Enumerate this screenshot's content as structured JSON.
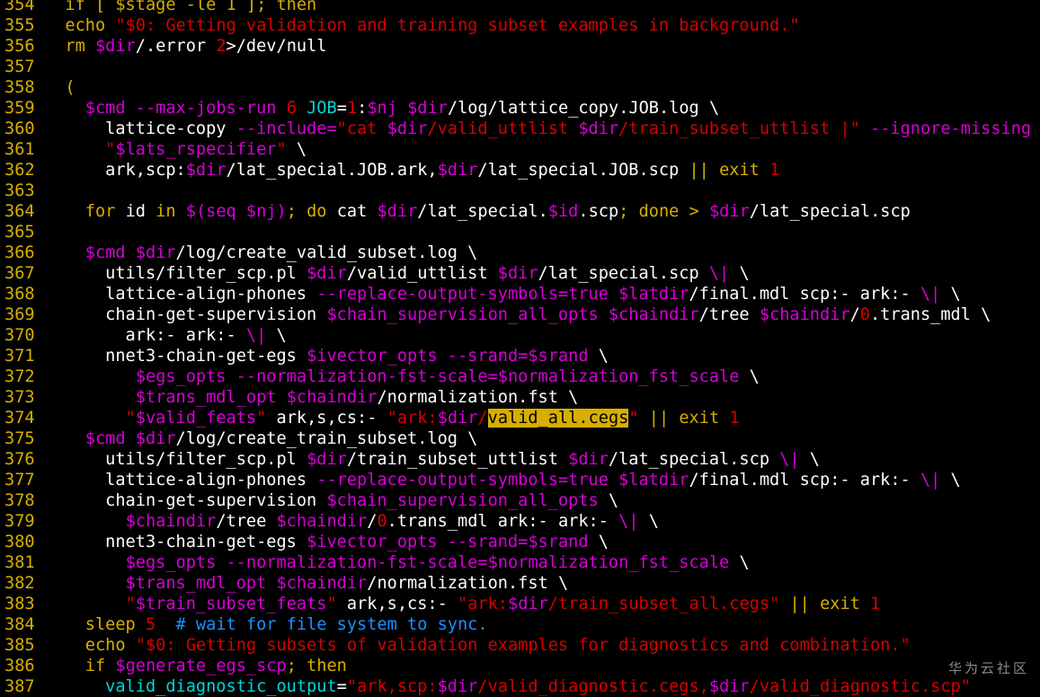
{
  "colors": {
    "background": "#000000",
    "line_number": "#d7af00",
    "default_text": "#ffffff",
    "keyword": "#d7af00",
    "string_literal": "#d70000",
    "variable": "#d700d7",
    "builtin": "#00d7d7",
    "comment": "#1e90ff",
    "search_highlight_bg": "#d7af00"
  },
  "editor": {
    "lines": [
      {
        "num": "354",
        "segments": [
          [
            "y",
            "  if [ $stage -le 1 ]; then"
          ]
        ]
      },
      {
        "num": "355",
        "segments": [
          [
            "y",
            "  echo "
          ],
          [
            "r",
            "\"$0: Getting validation and training subset examples in background.\""
          ]
        ]
      },
      {
        "num": "356",
        "segments": [
          [
            "y",
            "  rm "
          ],
          [
            "p",
            "$dir"
          ],
          [
            "w",
            "/.error "
          ],
          [
            "r",
            "2"
          ],
          [
            "w",
            ">/dev/null"
          ]
        ]
      },
      {
        "num": "357",
        "segments": []
      },
      {
        "num": "358",
        "segments": [
          [
            "y",
            "  ("
          ]
        ]
      },
      {
        "num": "359",
        "segments": [
          [
            "w",
            "    "
          ],
          [
            "p",
            "$cmd"
          ],
          [
            "w",
            " "
          ],
          [
            "p",
            "--max-jobs-run"
          ],
          [
            "w",
            " "
          ],
          [
            "r",
            "6"
          ],
          [
            "w",
            " "
          ],
          [
            "c",
            "JOB"
          ],
          [
            "w",
            "="
          ],
          [
            "r",
            "1"
          ],
          [
            "w",
            ":"
          ],
          [
            "p",
            "$nj"
          ],
          [
            "w",
            " "
          ],
          [
            "p",
            "$dir"
          ],
          [
            "w",
            "/log/lattice_copy.JOB.log \\"
          ]
        ]
      },
      {
        "num": "360",
        "segments": [
          [
            "w",
            "      lattice-copy "
          ],
          [
            "p",
            "--include="
          ],
          [
            "r",
            "\"cat "
          ],
          [
            "p",
            "$dir"
          ],
          [
            "r",
            "/valid_uttlist "
          ],
          [
            "p",
            "$dir"
          ],
          [
            "r",
            "/train_subset_uttlist |\""
          ],
          [
            "w",
            " "
          ],
          [
            "p",
            "--ignore-missing"
          ],
          [
            "w",
            " \\"
          ]
        ]
      },
      {
        "num": "361",
        "segments": [
          [
            "w",
            "      "
          ],
          [
            "r",
            "\""
          ],
          [
            "p",
            "$lats_rspecifier"
          ],
          [
            "r",
            "\""
          ],
          [
            "w",
            " \\"
          ]
        ]
      },
      {
        "num": "362",
        "segments": [
          [
            "w",
            "      ark,scp:"
          ],
          [
            "p",
            "$dir"
          ],
          [
            "w",
            "/lat_special.JOB.ark,"
          ],
          [
            "p",
            "$dir"
          ],
          [
            "w",
            "/lat_special.JOB.scp "
          ],
          [
            "y",
            "||"
          ],
          [
            "w",
            " "
          ],
          [
            "y",
            "exit"
          ],
          [
            "w",
            " "
          ],
          [
            "r",
            "1"
          ]
        ]
      },
      {
        "num": "363",
        "segments": []
      },
      {
        "num": "364",
        "segments": [
          [
            "w",
            "    "
          ],
          [
            "y",
            "for"
          ],
          [
            "w",
            " id "
          ],
          [
            "y",
            "in"
          ],
          [
            "w",
            " "
          ],
          [
            "p",
            "$(seq $nj)"
          ],
          [
            "y",
            ";"
          ],
          [
            "w",
            " "
          ],
          [
            "y",
            "do"
          ],
          [
            "w",
            " cat "
          ],
          [
            "p",
            "$dir"
          ],
          [
            "w",
            "/lat_special."
          ],
          [
            "p",
            "$id"
          ],
          [
            "w",
            ".scp"
          ],
          [
            "y",
            ";"
          ],
          [
            "w",
            " "
          ],
          [
            "y",
            "done"
          ],
          [
            "w",
            " "
          ],
          [
            "y",
            ">"
          ],
          [
            "w",
            " "
          ],
          [
            "p",
            "$dir"
          ],
          [
            "w",
            "/lat_special.scp"
          ]
        ]
      },
      {
        "num": "365",
        "segments": []
      },
      {
        "num": "366",
        "segments": [
          [
            "w",
            "    "
          ],
          [
            "p",
            "$cmd"
          ],
          [
            "w",
            " "
          ],
          [
            "p",
            "$dir"
          ],
          [
            "w",
            "/log/create_valid_subset.log \\"
          ]
        ]
      },
      {
        "num": "367",
        "segments": [
          [
            "w",
            "      utils/filter_scp.pl "
          ],
          [
            "p",
            "$dir"
          ],
          [
            "w",
            "/valid_uttlist "
          ],
          [
            "p",
            "$dir"
          ],
          [
            "w",
            "/lat_special.scp "
          ],
          [
            "p",
            "\\|"
          ],
          [
            "w",
            " \\"
          ]
        ]
      },
      {
        "num": "368",
        "segments": [
          [
            "w",
            "      lattice-align-phones "
          ],
          [
            "p",
            "--replace-output-symbols=true"
          ],
          [
            "w",
            " "
          ],
          [
            "p",
            "$latdir"
          ],
          [
            "w",
            "/final.mdl scp:- ark:- "
          ],
          [
            "p",
            "\\|"
          ],
          [
            "w",
            " \\"
          ]
        ]
      },
      {
        "num": "369",
        "segments": [
          [
            "w",
            "      chain-get-supervision "
          ],
          [
            "p",
            "$chain_supervision_all_opts"
          ],
          [
            "w",
            " "
          ],
          [
            "p",
            "$chaindir"
          ],
          [
            "w",
            "/tree "
          ],
          [
            "p",
            "$chaindir"
          ],
          [
            "w",
            "/"
          ],
          [
            "r",
            "0"
          ],
          [
            "w",
            ".trans_mdl \\"
          ]
        ]
      },
      {
        "num": "370",
        "segments": [
          [
            "w",
            "        ark:- ark:- "
          ],
          [
            "p",
            "\\|"
          ],
          [
            "w",
            " \\"
          ]
        ]
      },
      {
        "num": "371",
        "segments": [
          [
            "w",
            "      nnet3-chain-get-egs "
          ],
          [
            "p",
            "$ivector_opts"
          ],
          [
            "w",
            " "
          ],
          [
            "p",
            "--srand=$srand"
          ],
          [
            "w",
            " \\"
          ]
        ]
      },
      {
        "num": "372",
        "segments": [
          [
            "w",
            "         "
          ],
          [
            "p",
            "$egs_opts"
          ],
          [
            "w",
            " "
          ],
          [
            "p",
            "--normalization-fst-scale=$normalization_fst_scale"
          ],
          [
            "w",
            " \\"
          ]
        ]
      },
      {
        "num": "373",
        "segments": [
          [
            "w",
            "         "
          ],
          [
            "p",
            "$trans_mdl_opt"
          ],
          [
            "w",
            " "
          ],
          [
            "p",
            "$chaindir"
          ],
          [
            "w",
            "/normalization.fst \\"
          ]
        ]
      },
      {
        "num": "374",
        "segments": [
          [
            "w",
            "        "
          ],
          [
            "r",
            "\""
          ],
          [
            "p",
            "$valid_feats"
          ],
          [
            "r",
            "\""
          ],
          [
            "w",
            " ark,s,cs:- "
          ],
          [
            "r",
            "\"ark:"
          ],
          [
            "p",
            "$dir"
          ],
          [
            "r",
            "/"
          ],
          [
            "hl",
            "valid_all.cegs"
          ],
          [
            "r",
            "\""
          ],
          [
            "w",
            " "
          ],
          [
            "y",
            "||"
          ],
          [
            "w",
            " "
          ],
          [
            "y",
            "exit"
          ],
          [
            "w",
            " "
          ],
          [
            "r",
            "1"
          ]
        ]
      },
      {
        "num": "375",
        "segments": [
          [
            "w",
            "    "
          ],
          [
            "p",
            "$cmd"
          ],
          [
            "w",
            " "
          ],
          [
            "p",
            "$dir"
          ],
          [
            "w",
            "/log/create_train_subset.log \\"
          ]
        ]
      },
      {
        "num": "376",
        "segments": [
          [
            "w",
            "      utils/filter_scp.pl "
          ],
          [
            "p",
            "$dir"
          ],
          [
            "w",
            "/train_subset_uttlist "
          ],
          [
            "p",
            "$dir"
          ],
          [
            "w",
            "/lat_special.scp "
          ],
          [
            "p",
            "\\|"
          ],
          [
            "w",
            " \\"
          ]
        ]
      },
      {
        "num": "377",
        "segments": [
          [
            "w",
            "      lattice-align-phones "
          ],
          [
            "p",
            "--replace-output-symbols=true"
          ],
          [
            "w",
            " "
          ],
          [
            "p",
            "$latdir"
          ],
          [
            "w",
            "/final.mdl scp:- ark:- "
          ],
          [
            "p",
            "\\|"
          ],
          [
            "w",
            " \\"
          ]
        ]
      },
      {
        "num": "378",
        "segments": [
          [
            "w",
            "      chain-get-supervision "
          ],
          [
            "p",
            "$chain_supervision_all_opts"
          ],
          [
            "w",
            " \\"
          ]
        ]
      },
      {
        "num": "379",
        "segments": [
          [
            "w",
            "        "
          ],
          [
            "p",
            "$chaindir"
          ],
          [
            "w",
            "/tree "
          ],
          [
            "p",
            "$chaindir"
          ],
          [
            "w",
            "/"
          ],
          [
            "r",
            "0"
          ],
          [
            "w",
            ".trans_mdl ark:- ark:- "
          ],
          [
            "p",
            "\\|"
          ],
          [
            "w",
            " \\"
          ]
        ]
      },
      {
        "num": "380",
        "segments": [
          [
            "w",
            "      nnet3-chain-get-egs "
          ],
          [
            "p",
            "$ivector_opts"
          ],
          [
            "w",
            " "
          ],
          [
            "p",
            "--srand=$srand"
          ],
          [
            "w",
            " \\"
          ]
        ]
      },
      {
        "num": "381",
        "segments": [
          [
            "w",
            "        "
          ],
          [
            "p",
            "$egs_opts"
          ],
          [
            "w",
            " "
          ],
          [
            "p",
            "--normalization-fst-scale=$normalization_fst_scale"
          ],
          [
            "w",
            " \\"
          ]
        ]
      },
      {
        "num": "382",
        "segments": [
          [
            "w",
            "        "
          ],
          [
            "p",
            "$trans_mdl_opt"
          ],
          [
            "w",
            " "
          ],
          [
            "p",
            "$chaindir"
          ],
          [
            "w",
            "/normalization.fst \\"
          ]
        ]
      },
      {
        "num": "383",
        "segments": [
          [
            "w",
            "        "
          ],
          [
            "r",
            "\""
          ],
          [
            "p",
            "$train_subset_feats"
          ],
          [
            "r",
            "\""
          ],
          [
            "w",
            " ark,s,cs:- "
          ],
          [
            "r",
            "\"ark:"
          ],
          [
            "p",
            "$dir"
          ],
          [
            "r",
            "/train_subset_all.cegs\""
          ],
          [
            "w",
            " "
          ],
          [
            "y",
            "||"
          ],
          [
            "w",
            " "
          ],
          [
            "y",
            "exit"
          ],
          [
            "w",
            " "
          ],
          [
            "r",
            "1"
          ]
        ]
      },
      {
        "num": "384",
        "segments": [
          [
            "y",
            "    sleep "
          ],
          [
            "r",
            "5"
          ],
          [
            "w",
            "  "
          ],
          [
            "b",
            "# wait for file system to sync."
          ]
        ]
      },
      {
        "num": "385",
        "segments": [
          [
            "y",
            "    echo "
          ],
          [
            "r",
            "\"$0: Getting subsets of validation examples for diagnostics and combination.\""
          ]
        ]
      },
      {
        "num": "386",
        "segments": [
          [
            "y",
            "    if "
          ],
          [
            "p",
            "$generate_egs_scp"
          ],
          [
            "y",
            "; then"
          ]
        ]
      },
      {
        "num": "387",
        "segments": [
          [
            "w",
            "      "
          ],
          [
            "c",
            "valid_diagnostic_output"
          ],
          [
            "w",
            "="
          ],
          [
            "r",
            "\"ark,scp:"
          ],
          [
            "p",
            "$dir"
          ],
          [
            "r",
            "/valid_diagnostic.cegs,"
          ],
          [
            "p",
            "$dir"
          ],
          [
            "r",
            "/valid_diagnostic.scp\""
          ]
        ]
      }
    ]
  },
  "watermark": {
    "text": "华为云社区"
  }
}
